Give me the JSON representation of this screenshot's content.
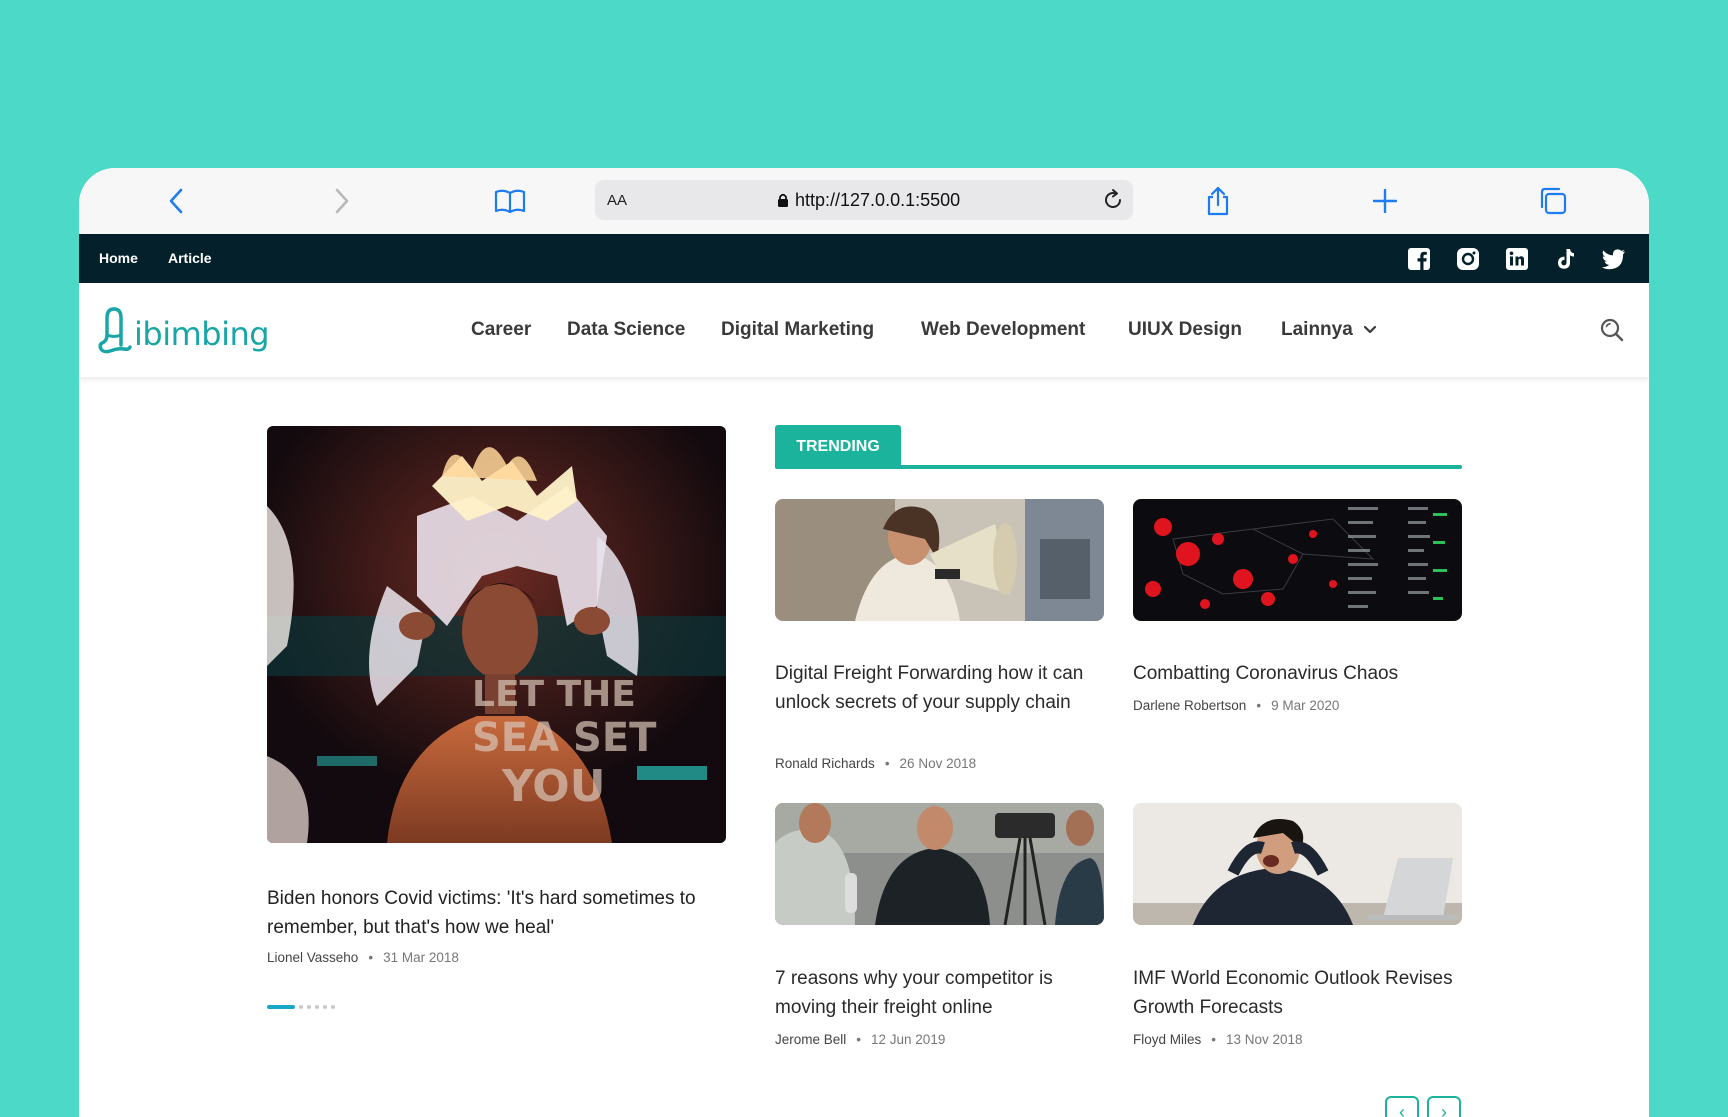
{
  "browser": {
    "text_size_label": "AA",
    "url": "http://127.0.0.1:5500"
  },
  "topbar": {
    "links": [
      "Home",
      "Article"
    ],
    "social": [
      "facebook-icon",
      "instagram-icon",
      "linkedin-icon",
      "tiktok-icon",
      "twitter-icon"
    ]
  },
  "header": {
    "logo_text": "ibimbing",
    "menu": [
      "Career",
      "Data Science",
      "Digital Marketing",
      "Web Development",
      "UIUX Design",
      "Lainnya"
    ]
  },
  "hero": {
    "title": "Biden honors Covid victims: 'It's hard sometimes to remember, but that's how we heal'",
    "author": "Lionel Vasseho",
    "date": "31 Mar 2018",
    "slide_count": 6,
    "active_slide": 1
  },
  "trending": {
    "label": "TRENDING",
    "cards": [
      {
        "title": "Digital Freight Forwarding how it can unlock secrets of your supply chain",
        "author": "Ronald Richards",
        "date": "26 Nov 2018"
      },
      {
        "title": "Combatting Coronavirus Chaos",
        "author": "Darlene Robertson",
        "date": "9 Mar 2020"
      },
      {
        "title": "7 reasons why your competitor is moving their freight online",
        "author": "Jerome Bell",
        "date": "12 Jun 2019"
      },
      {
        "title": "IMF World Economic Outlook Revises Growth Forecasts",
        "author": "Floyd Miles",
        "date": "13 Nov 2018"
      }
    ],
    "prev_label": "‹",
    "next_label": "›"
  },
  "colors": {
    "background": "#4cd9c7",
    "topbar": "#04202b",
    "accent": "#1bb39c",
    "logo": "#1aa6a6",
    "slider_active": "#19a7c9"
  }
}
